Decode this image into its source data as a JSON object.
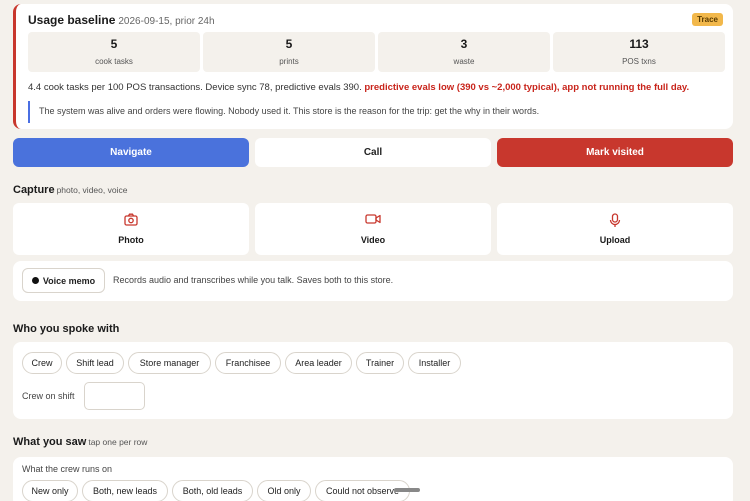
{
  "baseline": {
    "title": "Usage baseline",
    "subtitle": "2026-09-15, prior 24h",
    "badge": "Trace",
    "stats": [
      {
        "value": "5",
        "label": "cook tasks"
      },
      {
        "value": "5",
        "label": "prints"
      },
      {
        "value": "3",
        "label": "waste"
      },
      {
        "value": "113",
        "label": "POS txns"
      }
    ],
    "summary": "4.4 cook tasks per 100 POS transactions. Device sync 78, predictive evals 390.",
    "alert": "predictive evals low (390 vs ~2,000 typical), app not running the full day.",
    "quote": "The system was alive and orders were flowing. Nobody used it. This store is the reason for the trip: get the why in their words."
  },
  "actions": {
    "navigate": "Navigate",
    "call": "Call",
    "mark_visited": "Mark visited"
  },
  "capture": {
    "heading": "Capture",
    "hint": "photo, video, voice",
    "photo": "Photo",
    "video": "Video",
    "upload": "Upload",
    "voice_memo": "Voice memo",
    "voice_desc": "Records audio and transcribes while you talk. Saves both to this store."
  },
  "spoke": {
    "heading": "Who you spoke with",
    "chips": [
      "Crew",
      "Shift lead",
      "Store manager",
      "Franchisee",
      "Area leader",
      "Trainer",
      "Installer"
    ],
    "crew_label": "Crew on shift",
    "crew_value": ""
  },
  "saw": {
    "heading": "What you saw",
    "hint": "tap one per row",
    "row_label": "What the crew runs on",
    "chips": [
      "New only",
      "Both, new leads",
      "Both, old leads",
      "Old only",
      "Could not observe"
    ]
  },
  "colors": {
    "accent_red": "#c8372d",
    "accent_blue": "#4a72dc",
    "badge": "#f2b84b"
  }
}
